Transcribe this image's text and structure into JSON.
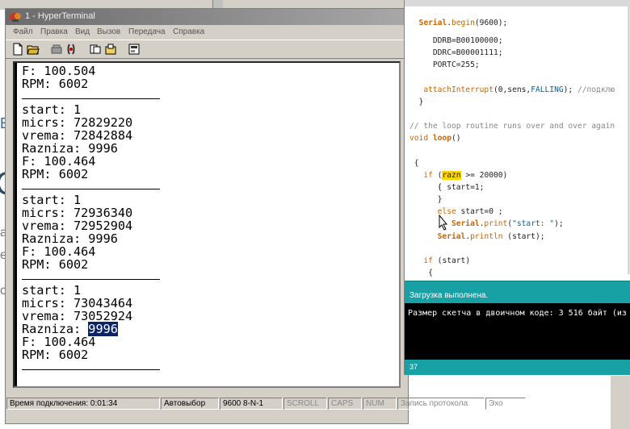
{
  "hyperterminal": {
    "title": "1 - HyperTerminal",
    "menu": [
      "Файл",
      "Правка",
      "Вид",
      "Вызов",
      "Передача",
      "Справка"
    ],
    "toolbar_icons": [
      "new-icon",
      "open-icon",
      "disconnect-icon",
      "call-icon",
      "send-icon",
      "receive-icon",
      "properties-icon"
    ],
    "terminal_lines": [
      {
        "t": "F: 100.504"
      },
      {
        "t": "RPM: 6002"
      },
      {
        "sep": true
      },
      {
        "t": "start: 1"
      },
      {
        "t": "micrs: 72829220"
      },
      {
        "t": "vrema: 72842884"
      },
      {
        "t": "Razniza: 9996"
      },
      {
        "t": "F: 100.464"
      },
      {
        "t": "RPM: 6002"
      },
      {
        "sep": true
      },
      {
        "t": "start: 1"
      },
      {
        "t": "micrs: 72936340"
      },
      {
        "t": "vrema: 72952904"
      },
      {
        "t": "Razniza: 9996"
      },
      {
        "t": "F: 100.464"
      },
      {
        "t": "RPM: 6002"
      },
      {
        "sep": true
      },
      {
        "t": "start: 1"
      },
      {
        "t": "micrs: 73043464"
      },
      {
        "t": "vrema: 73052924"
      },
      {
        "t": "Razniza: ",
        "hl": "9996"
      },
      {
        "t": "F: 100.464"
      },
      {
        "t": "RPM: 6002"
      },
      {
        "sep": true
      }
    ],
    "status": {
      "connection_time": "Время подключения: 0:01:34",
      "detect": "Автовыбор",
      "params": "9600 8-N-1",
      "scroll": "SCROLL",
      "caps": "CAPS",
      "num": "NUM",
      "capture": "Запись протокола",
      "echo": "Эхо"
    }
  },
  "arduino": {
    "code_lines": [
      [
        {
          "c": "kw2",
          "t": "  Serial"
        },
        {
          "t": "."
        },
        {
          "c": "kw",
          "t": "begin"
        },
        {
          "t": "(9600);"
        }
      ],
      [
        {
          "t": "     DDRB=B00100000;"
        }
      ],
      [
        {
          "t": "     DDRC=B00001111;"
        }
      ],
      [
        {
          "t": "     PORTC=255;"
        }
      ],
      [
        {
          "t": ""
        }
      ],
      [
        {
          "c": "kw",
          "t": "   attachInterrupt"
        },
        {
          "t": "(0,sens,"
        },
        {
          "c": "const",
          "t": "FALLING"
        },
        {
          "t": "); "
        },
        {
          "c": "cm",
          "t": "//подклю"
        }
      ],
      [
        {
          "t": "  }"
        }
      ],
      [
        {
          "t": ""
        }
      ],
      [
        {
          "c": "cm",
          "t": "// the loop routine runs over and over again"
        }
      ],
      [
        {
          "c": "kw",
          "t": "void"
        },
        {
          "t": " "
        },
        {
          "c": "kw2",
          "t": "loop"
        },
        {
          "t": "()"
        }
      ],
      [
        {
          "t": ""
        }
      ],
      [
        {
          "t": " {"
        }
      ],
      [
        {
          "c": "kw",
          "t": "   if"
        },
        {
          "t": " ("
        },
        {
          "c": "var-hl",
          "t": "razn"
        },
        {
          "t": " >= 20000)"
        }
      ],
      [
        {
          "t": "      { start=1;"
        }
      ],
      [
        {
          "t": "      }"
        }
      ],
      [
        {
          "c": "kw",
          "t": "      else"
        },
        {
          "t": " start=0 ;"
        }
      ],
      [
        {
          "c": "kw2",
          "t": "         Serial"
        },
        {
          "t": "."
        },
        {
          "c": "kw",
          "t": "print"
        },
        {
          "t": "("
        },
        {
          "c": "str",
          "t": "\"start: \""
        },
        {
          "t": ");"
        }
      ],
      [
        {
          "c": "kw2",
          "t": "      Serial"
        },
        {
          "t": "."
        },
        {
          "c": "kw",
          "t": "println"
        },
        {
          "t": " (start);"
        }
      ],
      [
        {
          "t": ""
        }
      ],
      [
        {
          "c": "kw",
          "t": "   if"
        },
        {
          "t": " (start)"
        }
      ],
      [
        {
          "t": "    {"
        }
      ]
    ],
    "status_message": "Загрузка выполнена.",
    "console_text": "Размер скетча в двоичном коде: 3 516 байт (из",
    "line_number": "37"
  },
  "background": {
    "fragments": [
      "B",
      "C",
      "a",
      "e",
      "c"
    ]
  }
}
